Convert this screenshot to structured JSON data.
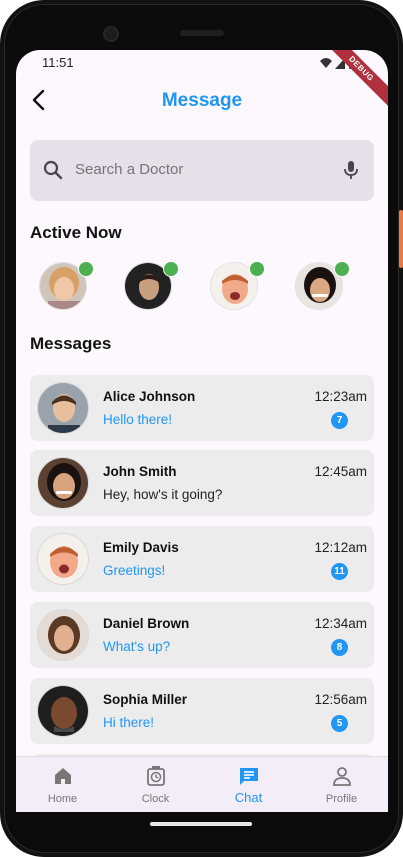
{
  "status_bar": {
    "time": "11:51",
    "debug_label": "DEBUG"
  },
  "app_bar": {
    "title": "Message",
    "back_icon": "arrow-back-icon"
  },
  "search": {
    "placeholder": "Search a Doctor",
    "icon": "search-icon",
    "mic_icon": "mic-icon"
  },
  "sections": {
    "active_title": "Active Now",
    "messages_title": "Messages"
  },
  "active_now": [
    {
      "name": "active-user-1",
      "online": true
    },
    {
      "name": "active-user-2",
      "online": true
    },
    {
      "name": "active-user-3",
      "online": true
    },
    {
      "name": "active-user-4",
      "online": true
    }
  ],
  "messages": [
    {
      "name": "Alice Johnson",
      "text": "Hello there!",
      "time": "12:23am",
      "unread": "7",
      "text_color": "#2196f3"
    },
    {
      "name": "John Smith",
      "text": "Hey, how's it going?",
      "time": "12:45am",
      "unread": "",
      "text_color": "#222222"
    },
    {
      "name": "Emily Davis",
      "text": "Greetings!",
      "time": "12:12am",
      "unread": "11",
      "text_color": "#2196f3"
    },
    {
      "name": "Daniel Brown",
      "text": "What's up?",
      "time": "12:34am",
      "unread": "8",
      "text_color": "#2196f3"
    },
    {
      "name": "Sophia Miller",
      "text": "Hi there!",
      "time": "12:56am",
      "unread": "5",
      "text_color": "#2196f3"
    }
  ],
  "bottom_nav": [
    {
      "label": "Home",
      "icon": "home-icon",
      "active": false
    },
    {
      "label": "Clock",
      "icon": "clock-icon",
      "active": false
    },
    {
      "label": "Chat",
      "icon": "chat-icon",
      "active": true
    },
    {
      "label": "Profile",
      "icon": "profile-icon",
      "active": false
    }
  ],
  "colors": {
    "accent": "#2196f3",
    "online": "#4caf50",
    "search_bg": "#e6e0e9",
    "card_bg": "#ececec"
  }
}
